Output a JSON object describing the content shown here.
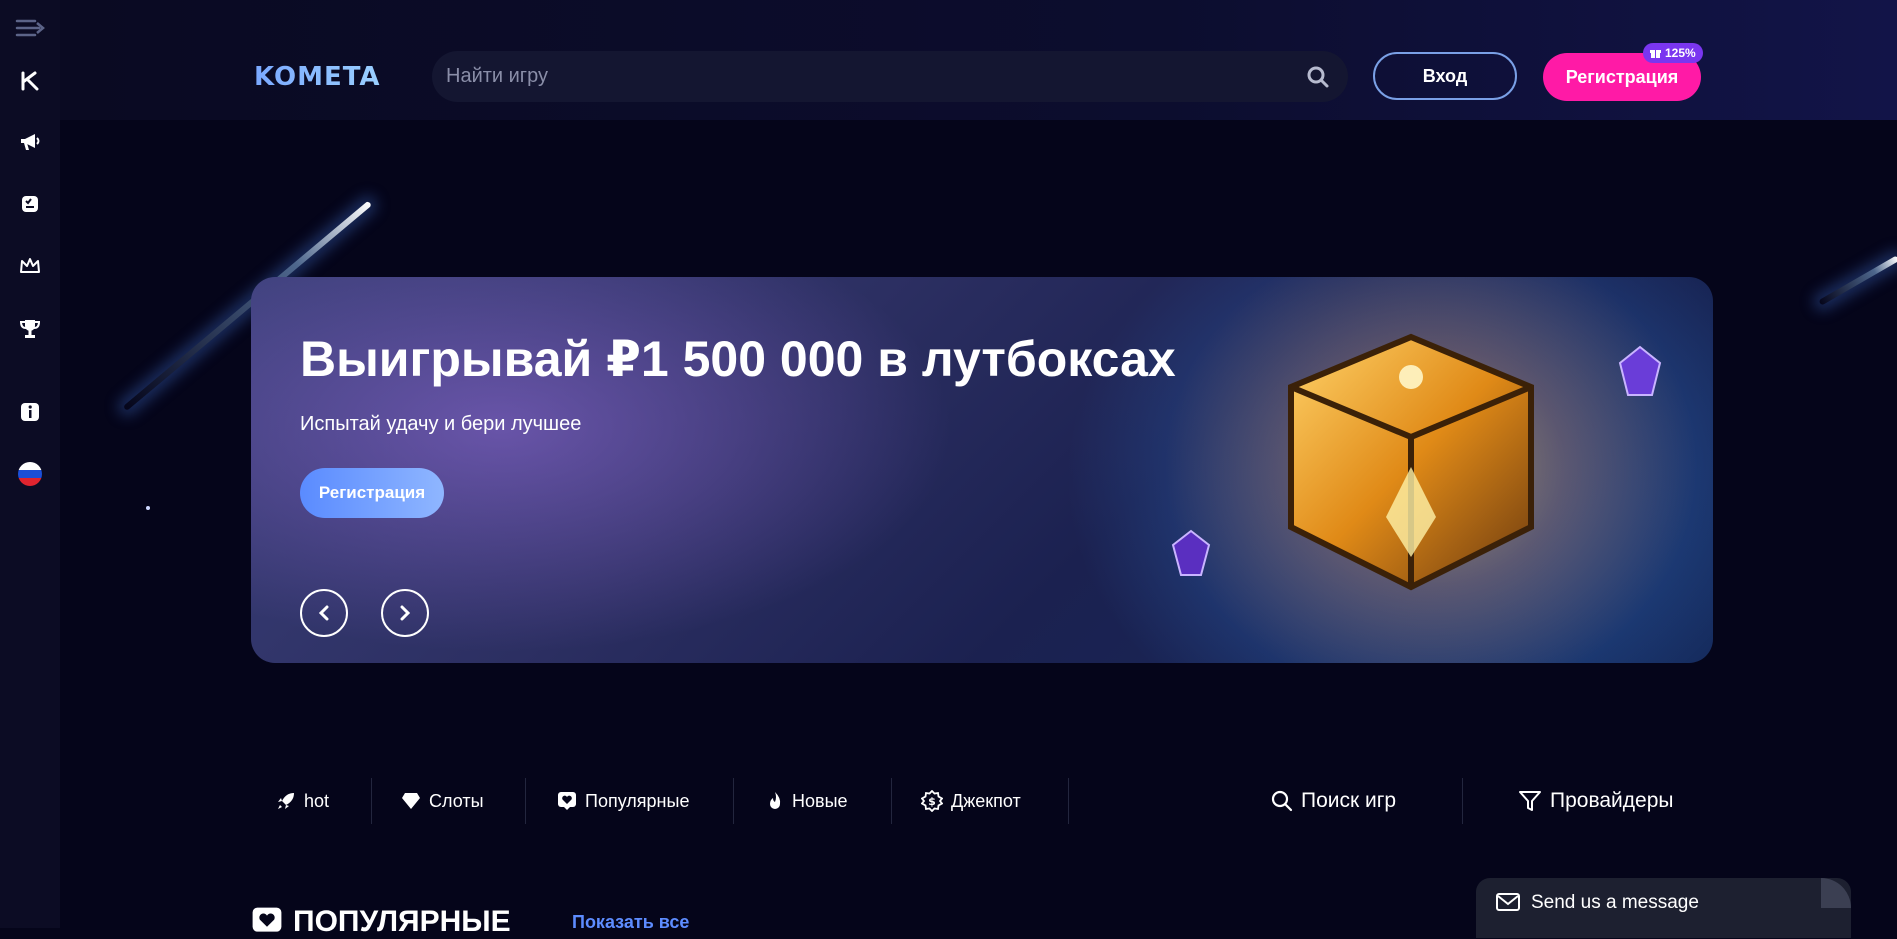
{
  "sidebar": {
    "items": [
      {
        "icon": "menu-collapse-icon"
      },
      {
        "icon": "kometa-k-icon"
      },
      {
        "icon": "megaphone-icon"
      },
      {
        "icon": "ticket-icon"
      },
      {
        "icon": "crown-icon"
      },
      {
        "icon": "trophy-icon"
      },
      {
        "icon": "info-icon"
      },
      {
        "icon": "russia-flag-icon"
      }
    ]
  },
  "header": {
    "logo": "KOMETA",
    "search_placeholder": "Найти игру",
    "login_label": "Вход",
    "register_label": "Регистрация",
    "bonus_badge": "125%"
  },
  "banner": {
    "title": "Выигрывай ₽1 500 000 в лутбоксах",
    "subtitle": "Испытай удачу и бери лучшее",
    "cta_label": "Регистрация"
  },
  "categories": [
    {
      "label": "hot",
      "icon": "rocket-icon"
    },
    {
      "label": "Слоты",
      "icon": "diamond-icon"
    },
    {
      "label": "Популярные",
      "icon": "heart-icon"
    },
    {
      "label": "Новые",
      "icon": "flame-icon"
    },
    {
      "label": "Джекпот",
      "icon": "jackpot-icon"
    }
  ],
  "tools": {
    "search_games": "Поиск игр",
    "providers": "Провайдеры"
  },
  "section": {
    "title": "ПОПУЛЯРНЫЕ",
    "show_all": "Показать все"
  },
  "chat": {
    "label": "Send us a message"
  },
  "colors": {
    "background": "#05051a",
    "sidebar": "#0c0c24",
    "register_pink": "#ff1aa6",
    "accent_blue": "#5d8cff",
    "badge_purple": "#7a36f0"
  }
}
